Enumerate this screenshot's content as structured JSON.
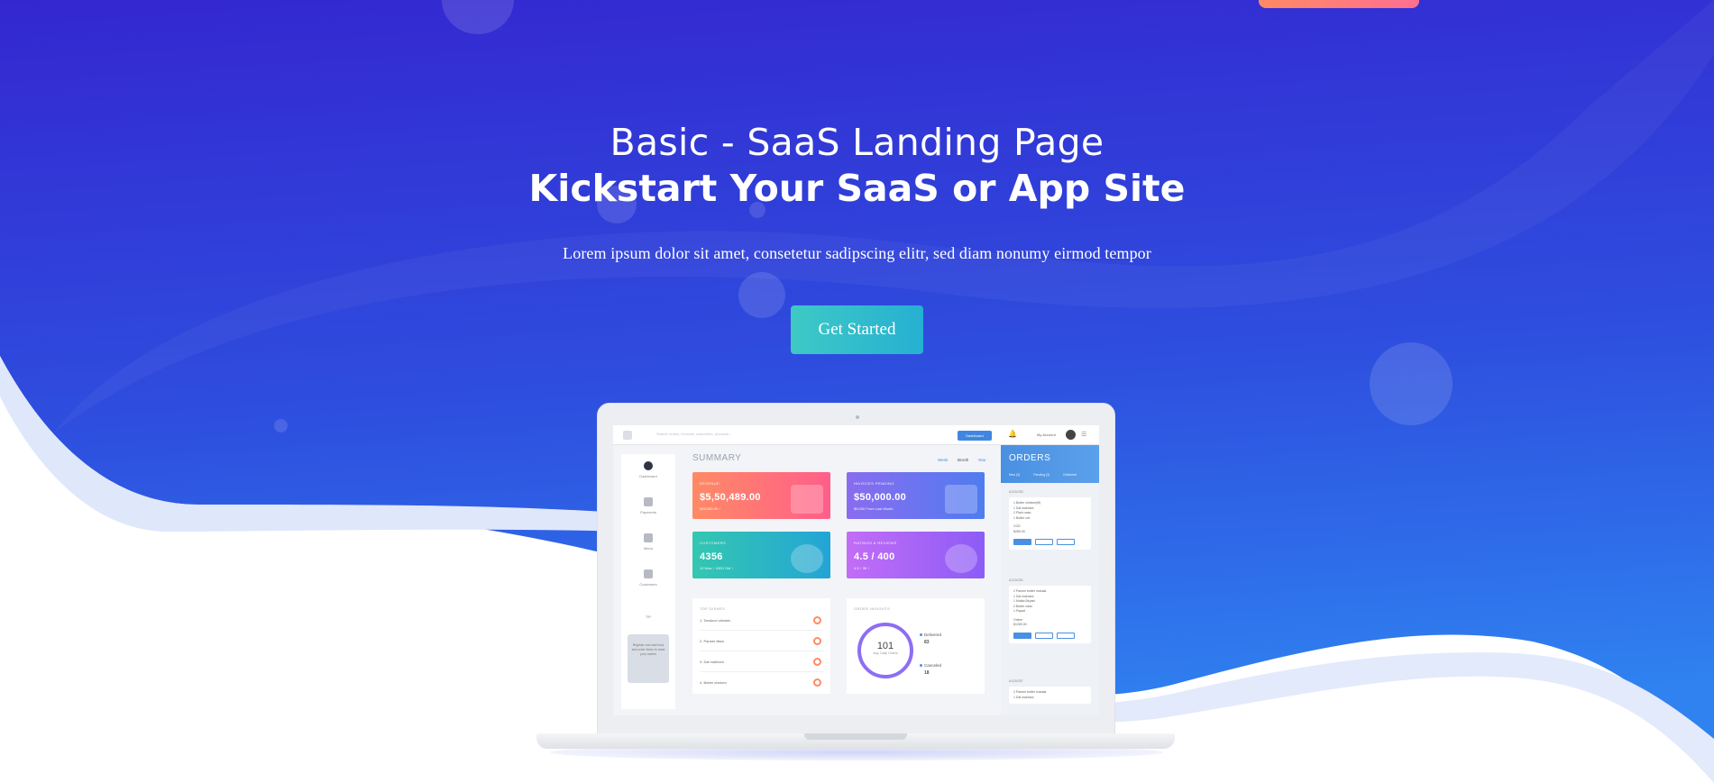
{
  "colors": {
    "hero_top": "#3427d0",
    "hero_bottom": "#2f7ef0",
    "cta_start": "#3ec9c6",
    "cta_end": "#26b0d2",
    "top_cta": "#ff7a76"
  },
  "hero": {
    "title": "Basic - SaaS Landing Page",
    "title_bold": "Kickstart Your SaaS or App Site",
    "subtitle": "Lorem ipsum dolor sit amet, consetetur sadipscing elitr, sed diam nonumy eirmod tempor",
    "cta_label": "Get Started"
  },
  "dashboard": {
    "search_placeholder": "Search orders, invoices, customers, products...",
    "dashboard_button": "Dashboard",
    "account_label": "My Account",
    "notification_count": "2",
    "sidebar": [
      {
        "label": "Dashboard",
        "icon": "dashboard-icon"
      },
      {
        "label": "Payments",
        "icon": "calendar-icon"
      },
      {
        "label": "Menu",
        "icon": "menu-icon"
      },
      {
        "label": "Customers",
        "icon": "customers-icon"
      }
    ],
    "tip_label": "TIP",
    "tip_text": "Register and add food and order items to track your orders",
    "summary_title": "SUMMARY",
    "periods": [
      "Week",
      "Month",
      "Year"
    ],
    "cards": [
      {
        "label": "REVENUE",
        "value": "$5,50,489.00",
        "sub": "$55,000.00 ↑"
      },
      {
        "label": "INVOICES PENDING",
        "value": "$50,000.00",
        "sub": "$5,000 From Last Month"
      },
      {
        "label": "CUSTOMERS",
        "value": "4356",
        "sub": "12 New ↑      4300 Old ↑"
      },
      {
        "label": "RATINGS & REVIEWS",
        "value": "4.5 / 400",
        "sub": "4.5 ↑       35 ↑"
      }
    ],
    "top_dishes_title": "TOP DISHES",
    "top_dishes": [
      "1. Tandoori chicken",
      "2. Paneer tikka",
      "3. Dal makhani",
      "4. Butter chicken"
    ],
    "order_insights_title": "ORDER INSIGHTS",
    "ring_value": "101",
    "ring_label": "Avg. Daily Orders",
    "delivered_label": "Delivered",
    "delivered_value": "83",
    "canceled_label": "Canceled",
    "canceled_value": "18",
    "orders_title": "ORDERS",
    "orders_tabs": [
      "New (3)",
      "Pending (2)",
      "Delivered"
    ],
    "orders": [
      {
        "id": "#1234783",
        "items": [
          "1 Butter chicken(M)",
          "1 Dal makhani",
          "2 Plain naan",
          "1 Butter roti"
        ],
        "payment": "COD",
        "amount": "$289.00"
      },
      {
        "id": "#1234784",
        "items": [
          "2 Paneer butter masala",
          "1 Dal makhani",
          "1 Matka Biryani",
          "2 Butter naan",
          "1 Papad"
        ],
        "payment": "Online",
        "amount": "$1269.00"
      },
      {
        "id": "#1234787",
        "items": [
          "2 Paneer butter masala",
          "1 Dal makhani"
        ]
      }
    ]
  }
}
